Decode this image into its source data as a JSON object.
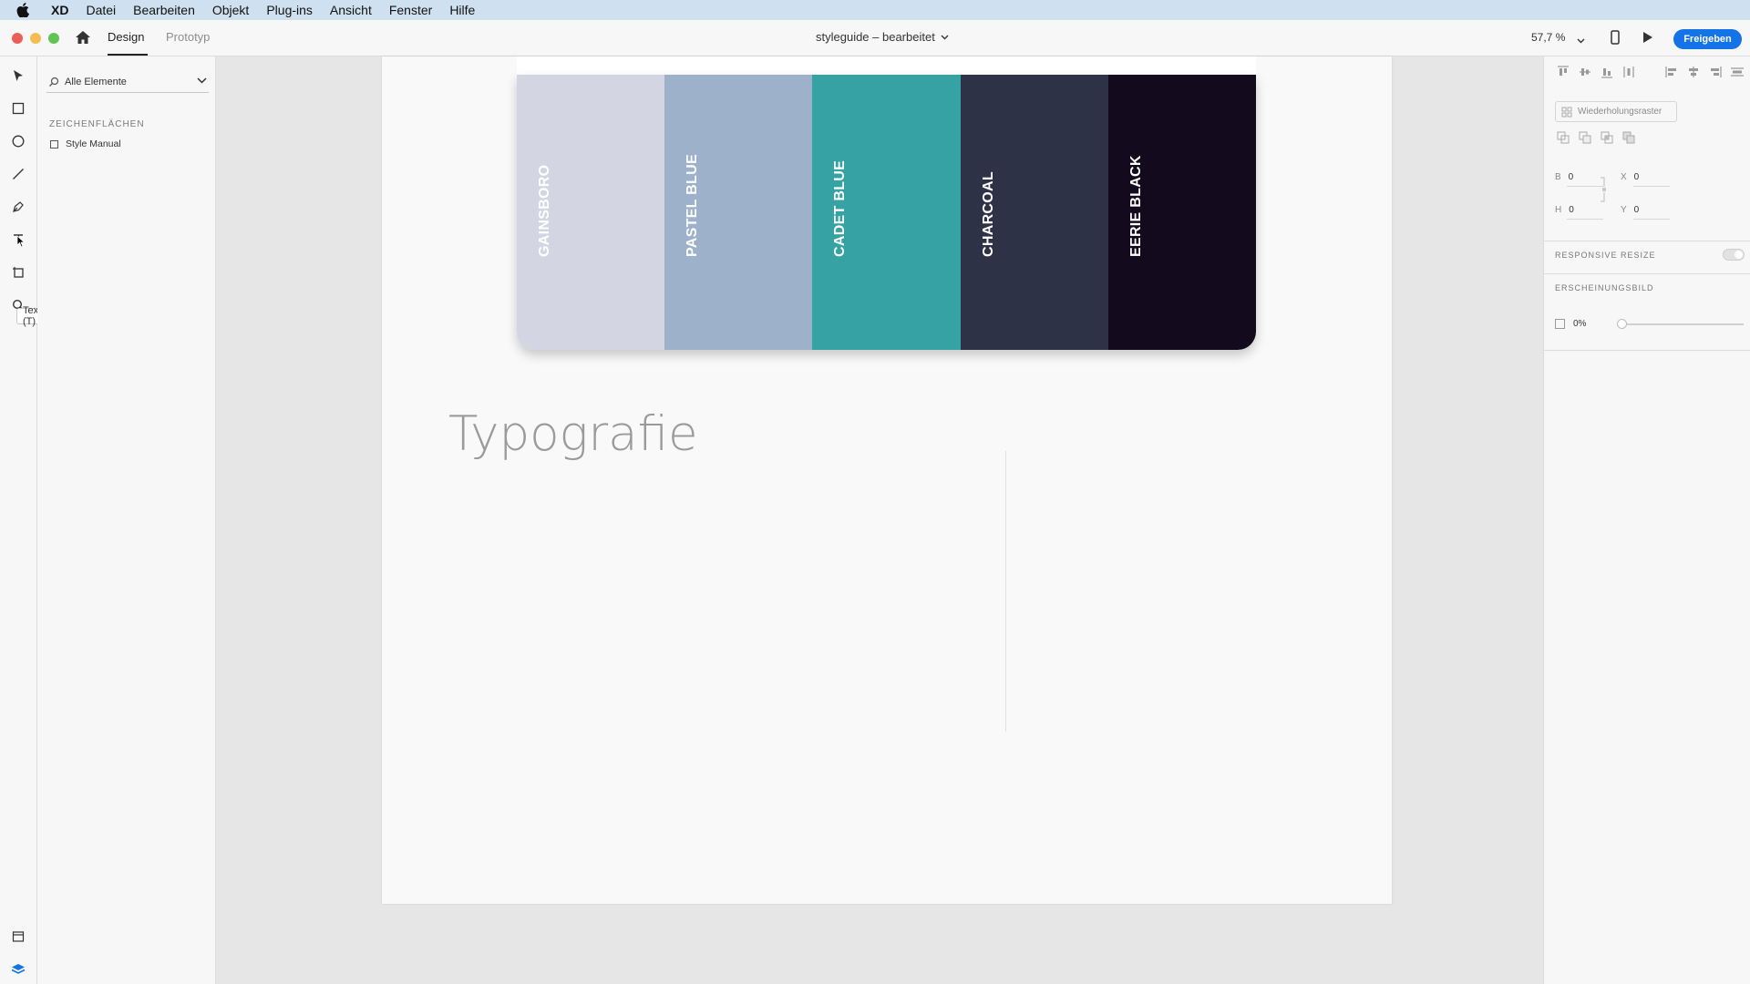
{
  "menubar": {
    "app": "XD",
    "items": [
      "Datei",
      "Bearbeiten",
      "Objekt",
      "Plug-ins",
      "Ansicht",
      "Fenster",
      "Hilfe"
    ]
  },
  "titlebar": {
    "tab_design": "Design",
    "tab_prototype": "Prototyp",
    "doc_title": "styleguide – bearbeitet",
    "zoom": "57,7 %",
    "share_label": "Freigeben"
  },
  "toolbar": {
    "tooltip": "Text (T)"
  },
  "layers": {
    "filter_label": "Alle Elemente",
    "artboards_heading": "ZEICHENFLÄCHEN",
    "artboard_name": "Style Manual"
  },
  "canvas": {
    "swatches": [
      {
        "name": "GAINSBORO",
        "color": "#d3d5e2"
      },
      {
        "name": "PASTEL BLUE",
        "color": "#9db1ca"
      },
      {
        "name": "CADET BLUE",
        "color": "#36a2a3"
      },
      {
        "name": "CHARCOAL",
        "color": "#2e3246"
      },
      {
        "name": "EERIE BLACK",
        "color": "#140a1e"
      }
    ],
    "typography_heading": "Typografie"
  },
  "props": {
    "repeat_grid_label": "Wiederholungsraster",
    "w_label": "B",
    "w_value": "0",
    "x_label": "X",
    "x_value": "0",
    "h_label": "H",
    "h_value": "0",
    "y_label": "Y",
    "y_value": "0",
    "responsive_heading": "RESPONSIVE RESIZE",
    "appearance_heading": "ERSCHEINUNGSBILD",
    "opacity_value": "0%",
    "opacity_slider_value": 0
  },
  "colors": {
    "accent": "#1473e6",
    "menubar_bg": "#cfe1f0"
  }
}
